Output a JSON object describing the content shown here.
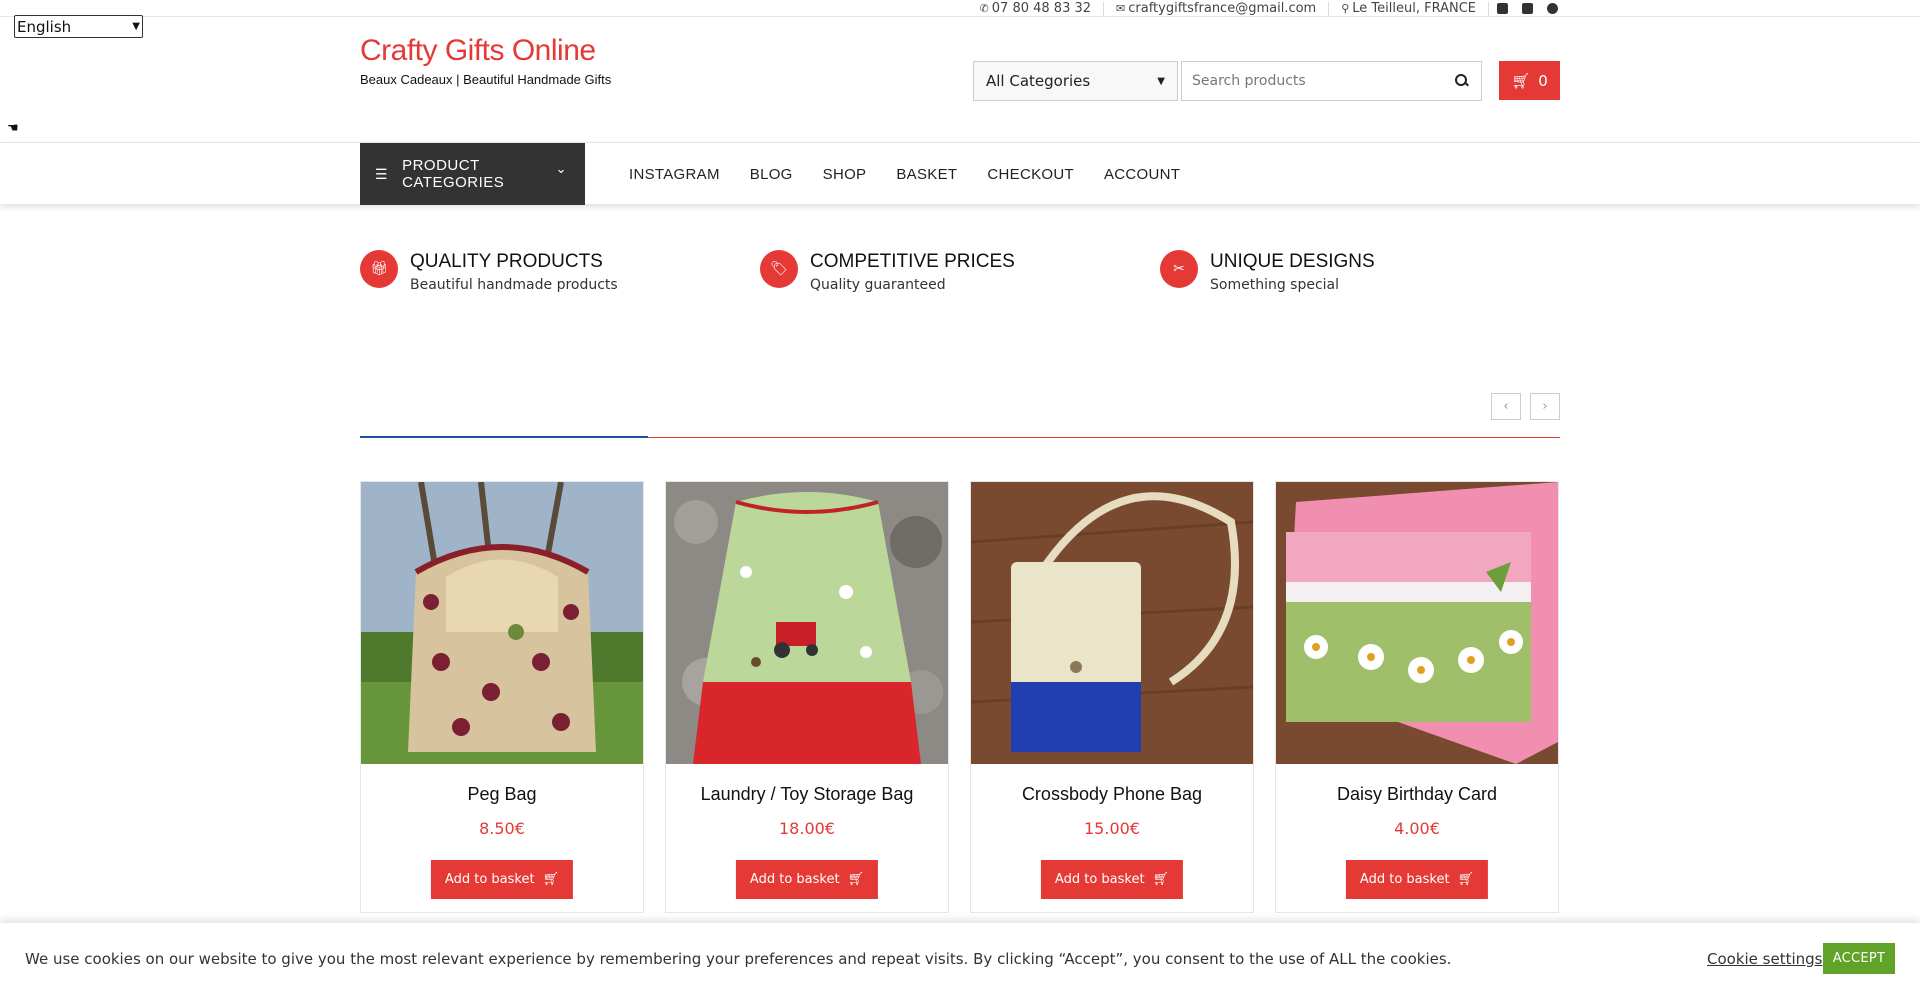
{
  "language": {
    "selected": "English"
  },
  "topbar": {
    "phone": "07 80 48 83 32",
    "email": "craftygiftsfrance@gmail.com",
    "location": "Le Teilleul, FRANCE",
    "socials": [
      "facebook-icon",
      "linkedin-icon",
      "pinterest-icon"
    ]
  },
  "brand": {
    "title": "Crafty Gifts Online",
    "tagline": "Beaux Cadeaux | Beautiful Handmade Gifts",
    "color": "#e53935"
  },
  "search": {
    "category": "All Categories",
    "placeholder": "Search products"
  },
  "cart": {
    "count": "0"
  },
  "nav": {
    "categories_label": "PRODUCT CATEGORIES",
    "items": [
      "INSTAGRAM",
      "BLOG",
      "SHOP",
      "BASKET",
      "CHECKOUT",
      "ACCOUNT"
    ]
  },
  "features": [
    {
      "icon": "gift-icon",
      "title": "QUALITY PRODUCTS",
      "subtitle": "Beautiful handmade products"
    },
    {
      "icon": "tags-icon",
      "title": "COMPETITIVE PRICES",
      "subtitle": "Quality guaranteed"
    },
    {
      "icon": "scissors-icon",
      "title": "UNIQUE DESIGNS",
      "subtitle": "Something special"
    }
  ],
  "products": [
    {
      "name": "Peg Bag",
      "price": "8.50€",
      "button": "Add to basket"
    },
    {
      "name": "Laundry / Toy Storage Bag",
      "price": "18.00€",
      "button": "Add to basket"
    },
    {
      "name": "Crossbody Phone Bag",
      "price": "15.00€",
      "button": "Add to basket"
    },
    {
      "name": "Daisy Birthday Card",
      "price": "4.00€",
      "button": "Add to basket"
    }
  ],
  "cookie": {
    "text": "We use cookies on our website to give you the most relevant experience by remembering your preferences and repeat visits. By clicking “Accept”, you consent to the use of ALL the cookies.",
    "settings": "Cookie settings",
    "accept": "ACCEPT"
  },
  "colors": {
    "accent": "#e53935",
    "dark": "#333333",
    "accept": "#61a229",
    "rule_blue": "#1e4fa0"
  }
}
